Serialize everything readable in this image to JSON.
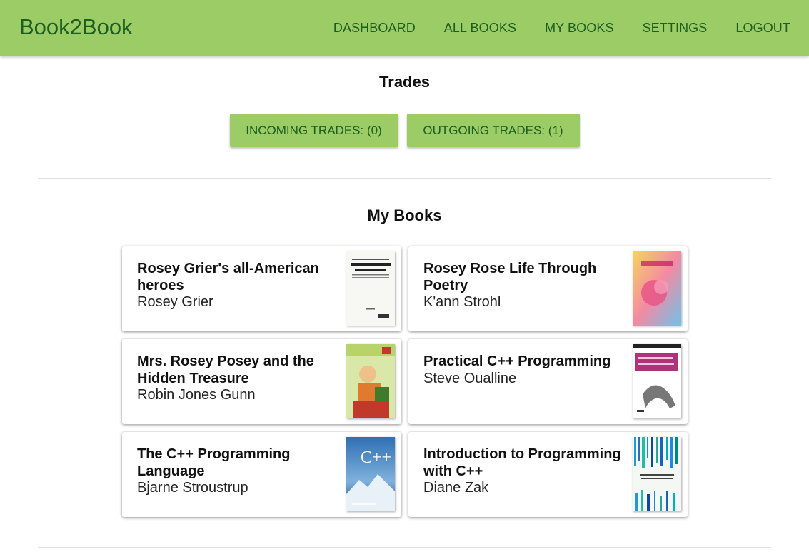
{
  "navbar": {
    "brand": "Book2Book",
    "links": [
      "DASHBOARD",
      "ALL BOOKS",
      "MY BOOKS",
      "SETTINGS",
      "LOGOUT"
    ],
    "color": "#9ccc65",
    "text_color": "#1b5e20"
  },
  "trades": {
    "title": "Trades",
    "incoming_label": "INCOMING TRADES: (0)",
    "outgoing_label": "OUTGOING TRADES: (1)"
  },
  "my_books": {
    "title": "My Books",
    "books": [
      {
        "title": "Rosey Grier's all-American heroes",
        "author": "Rosey Grier",
        "cover": "cover-image"
      },
      {
        "title": "Rosey Rose Life Through Poetry",
        "author": "K'ann Strohl",
        "cover": "cover-image"
      },
      {
        "title": "Mrs. Rosey Posey and the Hidden Treasure",
        "author": "Robin Jones Gunn",
        "cover": "cover-image"
      },
      {
        "title": "Practical C++ Programming",
        "author": "Steve Oualline",
        "cover": "cover-image"
      },
      {
        "title": "The C++ Programming Language",
        "author": "Bjarne Stroustrup",
        "cover": "cover-image"
      },
      {
        "title": "Introduction to Programming with C++",
        "author": "Diane Zak",
        "cover": "cover-image"
      }
    ]
  }
}
